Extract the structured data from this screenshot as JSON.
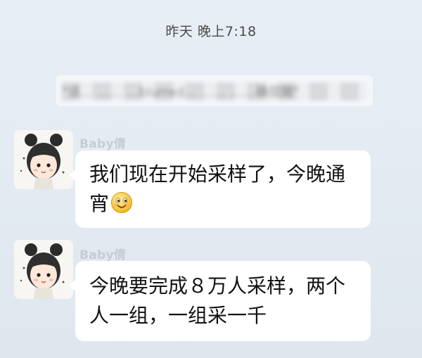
{
  "timestamp": "昨天 晚上7:18",
  "notice": {
    "text": "\"该… …… …blurred… …… ……确提醒\""
  },
  "messages": [
    {
      "sender": "Baby倩",
      "lines": [
        "我们现在开始采样了，今晚通",
        "宵"
      ],
      "emoji": "smiling-face-emoji"
    },
    {
      "sender": "Baby倩",
      "lines": [
        "今晚要完成８万人采样，两个",
        "人一组，一组采一千"
      ]
    }
  ]
}
